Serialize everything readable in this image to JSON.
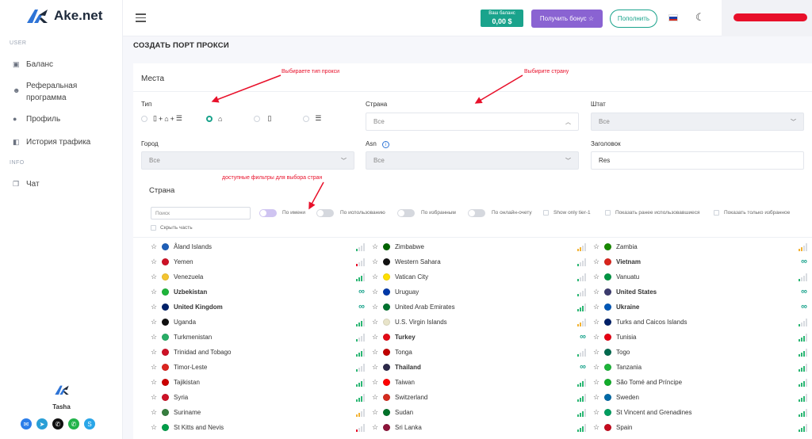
{
  "sidebar": {
    "logo_text": "Ake.net",
    "section_user": "USER",
    "items": [
      {
        "label": "Баланс",
        "icon": "wallet-icon"
      },
      {
        "label": "Реферальная программа",
        "icon": "users-icon"
      },
      {
        "label": "Профиль",
        "icon": "profile-icon"
      },
      {
        "label": "История трафика",
        "icon": "history-icon"
      }
    ],
    "section_info": "INFO",
    "chat": {
      "label": "Чат",
      "icon": "chat-icon"
    },
    "user_name": "Tasha",
    "socials": [
      {
        "name": "email",
        "color": "#2b7de9"
      },
      {
        "name": "telegram",
        "color": "#2a9fd6"
      },
      {
        "name": "viber",
        "color": "#111111"
      },
      {
        "name": "whatsapp",
        "color": "#22b34a"
      },
      {
        "name": "skype",
        "color": "#2aa6e8"
      }
    ]
  },
  "topbar": {
    "balance_label": "Ваш баланс",
    "balance_value": "0,00 $",
    "bonus_button": "Получить бонус ☆",
    "topup_button": "Пополнить"
  },
  "page_title": "СОЗДАТЬ ПОРТ ПРОКСИ",
  "card": {
    "title": "Места",
    "annotations": {
      "type": "Выбираете тип прокси",
      "country": "Выбирите страну",
      "filters": "доступные фильтры для выбора стран"
    },
    "type_label": "Тип",
    "country_label": "Страна",
    "country_value": "Все",
    "state_label": "Штат",
    "state_value": "Все",
    "city_label": "Город",
    "city_value": "Все",
    "asn_label": "Asn",
    "asn_value": "Все",
    "header_label": "Заголовок",
    "header_value": "Res",
    "list_title": "Страна"
  },
  "filters": {
    "search_placeholder": "Поиск",
    "by_name": "По имени",
    "by_usage": "По использованию",
    "by_favorite": "По избранным",
    "by_online": "По онлайн-очету",
    "tier1": "Show only tier-1",
    "previously_used": "Показать ранее использовавшиеся",
    "favorites_only": "Показать только избранное",
    "hide_part": "Скрыть часть"
  },
  "colors": {
    "accent": "#1aa38c",
    "purple": "#8a63d2",
    "red": "#e8102a",
    "sig_green": "#2bb673",
    "sig_yellow": "#f2b233",
    "sig_red": "#e8102a",
    "sig_gray": "#d9dce1"
  },
  "countries": [
    [
      {
        "name": "Åland Islands",
        "sig": "g1",
        "flag": "#1f5fb8"
      },
      {
        "name": "Yemen",
        "sig": "r1",
        "flag": "#ce1126"
      },
      {
        "name": "Venezuela",
        "sig": "g3",
        "flag": "#f4c430"
      },
      {
        "name": "Uzbekistan",
        "sig": "inf",
        "bold": true,
        "flag": "#1eb53a"
      },
      {
        "name": "United Kingdom",
        "sig": "inf",
        "bold": true,
        "flag": "#012169"
      },
      {
        "name": "Uganda",
        "sig": "g3",
        "flag": "#111111"
      },
      {
        "name": "Turkmenistan",
        "sig": "g1",
        "flag": "#28ae66"
      },
      {
        "name": "Trinidad and Tobago",
        "sig": "g3",
        "flag": "#ce1126"
      },
      {
        "name": "Timor-Leste",
        "sig": "g1",
        "flag": "#dc241f"
      },
      {
        "name": "Tajikistan",
        "sig": "g3",
        "flag": "#cc0000"
      },
      {
        "name": "Syria",
        "sig": "g3",
        "flag": "#ce1126"
      },
      {
        "name": "Suriname",
        "sig": "y2",
        "flag": "#377e3f"
      },
      {
        "name": "St Kitts and Nevis",
        "sig": "r1",
        "flag": "#009e49"
      }
    ],
    [
      {
        "name": "Zimbabwe",
        "sig": "y2",
        "flag": "#006400"
      },
      {
        "name": "Western Sahara",
        "sig": "g1",
        "flag": "#111111"
      },
      {
        "name": "Vatican City",
        "sig": "g1",
        "flag": "#ffe000"
      },
      {
        "name": "Uruguay",
        "sig": "g1",
        "flag": "#0038a8"
      },
      {
        "name": "United Arab Emirates",
        "sig": "g3",
        "flag": "#00732f"
      },
      {
        "name": "U.S. Virgin Islands",
        "sig": "y2",
        "flag": "#e8e4c9"
      },
      {
        "name": "Turkey",
        "sig": "inf",
        "bold": true,
        "flag": "#e30a17"
      },
      {
        "name": "Tonga",
        "sig": "g1",
        "flag": "#c10000"
      },
      {
        "name": "Thailand",
        "sig": "inf",
        "bold": true,
        "flag": "#2d2a4a"
      },
      {
        "name": "Taiwan",
        "sig": "g3",
        "flag": "#fe0000"
      },
      {
        "name": "Switzerland",
        "sig": "g3",
        "flag": "#d52b1e"
      },
      {
        "name": "Sudan",
        "sig": "g3",
        "flag": "#007229"
      },
      {
        "name": "Sri Lanka",
        "sig": "g3",
        "flag": "#8d153a"
      }
    ],
    [
      {
        "name": "Zambia",
        "sig": "y2",
        "flag": "#198a00"
      },
      {
        "name": "Vietnam",
        "sig": "inf",
        "bold": true,
        "flag": "#da251d"
      },
      {
        "name": "Vanuatu",
        "sig": "g1",
        "flag": "#009543"
      },
      {
        "name": "United States",
        "sig": "inf",
        "bold": true,
        "flag": "#3c3b6e"
      },
      {
        "name": "Ukraine",
        "sig": "inf",
        "bold": true,
        "flag": "#0057b7"
      },
      {
        "name": "Turks and Caicos Islands",
        "sig": "g1",
        "flag": "#012169"
      },
      {
        "name": "Tunisia",
        "sig": "g3",
        "flag": "#e70013"
      },
      {
        "name": "Togo",
        "sig": "g3",
        "flag": "#006a4e"
      },
      {
        "name": "Tanzania",
        "sig": "g3",
        "flag": "#1eb53a"
      },
      {
        "name": "São Tomé and Príncipe",
        "sig": "g3",
        "flag": "#12ad2b"
      },
      {
        "name": "Sweden",
        "sig": "g3",
        "flag": "#006aa7"
      },
      {
        "name": "St Vincent and Grenadines",
        "sig": "g3",
        "flag": "#009e60"
      },
      {
        "name": "Spain",
        "sig": "g3",
        "flag": "#c60b1e"
      }
    ]
  ]
}
